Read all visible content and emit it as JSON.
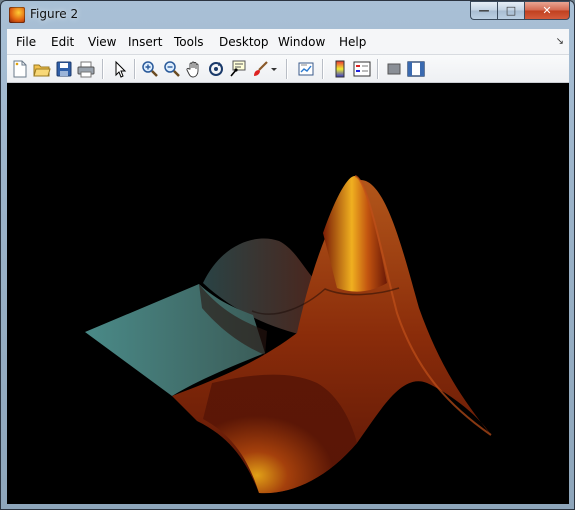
{
  "window": {
    "title": "Figure 2"
  },
  "menu": [
    "File",
    "Edit",
    "View",
    "Insert",
    "Tools",
    "Desktop",
    "Window",
    "Help"
  ],
  "icons": {
    "app": "matlab-figure-icon",
    "minimize": "minimize-icon",
    "maximize": "maximize-icon",
    "close": "close-icon",
    "dock": "dock-arrow-icon",
    "toolbar": [
      "new-figure-icon",
      "open-file-icon",
      "save-icon",
      "print-icon",
      "edit-plot-arrow-icon",
      "zoom-in-icon",
      "zoom-out-icon",
      "pan-hand-icon",
      "rotate-3d-icon",
      "data-cursor-icon",
      "brush-icon",
      "brush-dropdown-icon",
      "link-plot-icon",
      "insert-colorbar-icon",
      "insert-legend-icon",
      "hide-plot-tools-icon",
      "show-plot-tools-icon"
    ]
  },
  "colors": {
    "plot_background": "#000000",
    "surface_peak": "#f0b020",
    "surface_body": "#a03a0c",
    "surface_shadow": "#4a8a88"
  }
}
